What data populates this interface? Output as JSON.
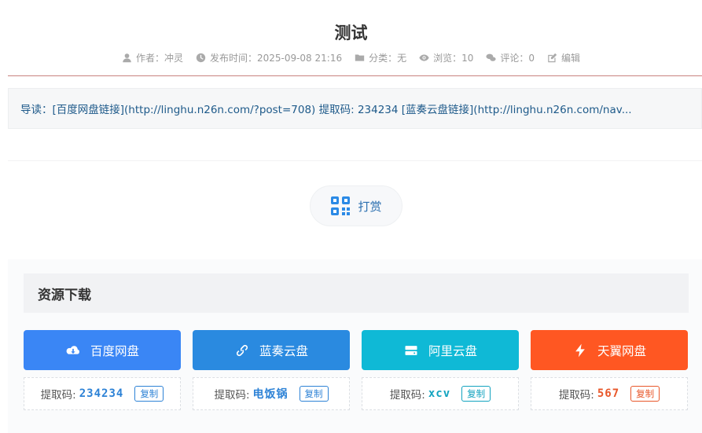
{
  "post": {
    "title": "测试",
    "meta": {
      "author": "作者：冲灵",
      "published": "发布时间：2025-09-08 21:16",
      "category": "分类：无",
      "views": "浏览：10",
      "comments": "评论：0",
      "edit": "编辑"
    },
    "summary": "导读：[百度网盘链接](http://linghu.n26n.com/?post=708) 提取码: 234234 [蓝奏云盘链接](http://linghu.n26n.com/nav..."
  },
  "reward": {
    "label": "打赏"
  },
  "downloads": {
    "header": "资源下载",
    "code_label": "提取码:",
    "copy_label": "复制",
    "items": [
      {
        "name": "百度网盘",
        "code": "234234",
        "color": "#3a86f5",
        "code_color": "#2d82d6",
        "icon": "cloud-download-icon"
      },
      {
        "name": "蓝奏云盘",
        "code": "电饭锅",
        "color": "#2a8ae0",
        "code_color": "#2d82d6",
        "icon": "link-icon"
      },
      {
        "name": "阿里云盘",
        "code": "xcv",
        "color": "#0fb9d6",
        "code_color": "#12a3bf",
        "icon": "drive-icon"
      },
      {
        "name": "天翼网盘",
        "code": "567",
        "color": "#ff5722",
        "code_color": "#e8572a",
        "icon": "bolt-icon"
      }
    ]
  }
}
